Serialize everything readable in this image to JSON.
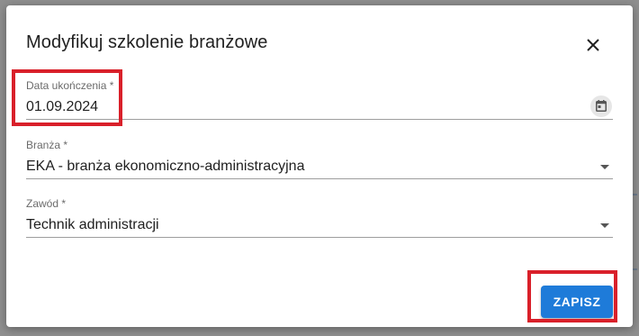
{
  "dialog": {
    "title": "Modyfikuj szkolenie branżowe",
    "close_icon": "close-icon"
  },
  "fields": {
    "completion_date": {
      "label": "Data ukończenia *",
      "value": "01.09.2024",
      "icon": "calendar-icon"
    },
    "industry": {
      "label": "Branża *",
      "value": "EKA - branża ekonomiczno-administracyjna",
      "icon": "chevron-down-icon"
    },
    "profession": {
      "label": "Zawód *",
      "value": "Technik administracji",
      "icon": "chevron-down-icon"
    }
  },
  "actions": {
    "save_label": "ZAPISZ"
  },
  "colors": {
    "primary": "#1e7bd9",
    "highlight": "#d9202a",
    "overlay": "#8f8f8f"
  }
}
